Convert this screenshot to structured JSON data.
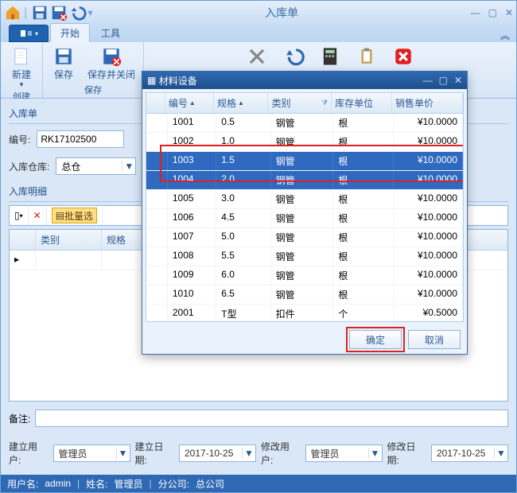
{
  "window": {
    "title": "入库单"
  },
  "qat_icons": [
    "home-icon",
    "save-icon",
    "save-close-icon",
    "undo-icon"
  ],
  "tabs": {
    "start": "开始",
    "tools": "工具"
  },
  "ribbon": {
    "create_group": "创建",
    "new_label": "新建",
    "save_group": "保存",
    "save_label": "保存",
    "save_close_label": "保存并关闭"
  },
  "form": {
    "section": "入库单",
    "code_label": "编号:",
    "code_value": "RK17102500",
    "warehouse_label": "入库仓库:",
    "warehouse_value": "总仓"
  },
  "detail": {
    "section": "入库明细",
    "bulk_label": "批量选",
    "columns": {
      "category": "类别",
      "spec": "规格"
    }
  },
  "remark_label": "备注:",
  "footer": {
    "create_user_label": "建立用户:",
    "create_user": "管理员",
    "create_date_label": "建立日期:",
    "create_date": "2017-10-25",
    "mod_user_label": "修改用户:",
    "mod_user": "管理员",
    "mod_date_label": "修改日期:",
    "mod_date": "2017-10-25"
  },
  "status": {
    "user_label": "用户名:",
    "user": "admin",
    "name_label": "姓名:",
    "name": "管理员",
    "company_label": "分公司:",
    "company": "总公司"
  },
  "dialog": {
    "title": "材料设备",
    "columns": {
      "code": "编号",
      "spec": "规格",
      "category": "类别",
      "unit": "库存单位",
      "price": "销售单价"
    },
    "rows": [
      {
        "code": "1001",
        "spec": "0.5",
        "category": "钢管",
        "unit": "根",
        "price": "¥10.0000",
        "selected": false
      },
      {
        "code": "1002",
        "spec": "1.0",
        "category": "钢管",
        "unit": "根",
        "price": "¥10.0000",
        "selected": false
      },
      {
        "code": "1003",
        "spec": "1.5",
        "category": "钢管",
        "unit": "根",
        "price": "¥10.0000",
        "selected": true
      },
      {
        "code": "1004",
        "spec": "2.0",
        "category": "钢管",
        "unit": "根",
        "price": "¥10.0000",
        "selected": true
      },
      {
        "code": "1005",
        "spec": "3.0",
        "category": "钢管",
        "unit": "根",
        "price": "¥10.0000",
        "selected": false
      },
      {
        "code": "1006",
        "spec": "4.5",
        "category": "钢管",
        "unit": "根",
        "price": "¥10.0000",
        "selected": false
      },
      {
        "code": "1007",
        "spec": "5.0",
        "category": "钢管",
        "unit": "根",
        "price": "¥10.0000",
        "selected": false
      },
      {
        "code": "1008",
        "spec": "5.5",
        "category": "钢管",
        "unit": "根",
        "price": "¥10.0000",
        "selected": false
      },
      {
        "code": "1009",
        "spec": "6.0",
        "category": "钢管",
        "unit": "根",
        "price": "¥10.0000",
        "selected": false
      },
      {
        "code": "1010",
        "spec": "6.5",
        "category": "钢管",
        "unit": "根",
        "price": "¥10.0000",
        "selected": false
      },
      {
        "code": "2001",
        "spec": "T型",
        "category": "扣件",
        "unit": "个",
        "price": "¥0.5000",
        "selected": false
      }
    ],
    "ok": "确定",
    "cancel": "取消"
  }
}
